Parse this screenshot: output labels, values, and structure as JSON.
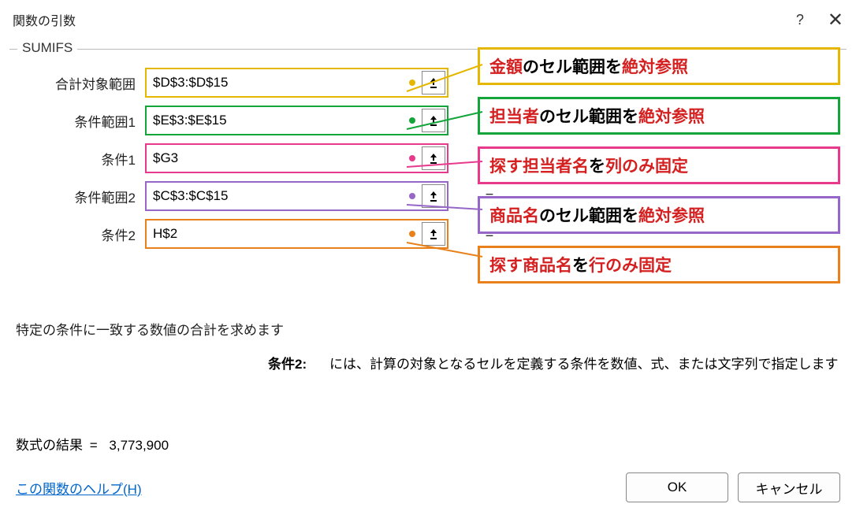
{
  "titlebar": {
    "title": "関数の引数",
    "help": "?",
    "close": "✕"
  },
  "group": {
    "label": "SUMIFS"
  },
  "rows": [
    {
      "label": "合計対象範囲",
      "value": "$D$3:$D$15",
      "color": "yellow"
    },
    {
      "label": "条件範囲1",
      "value": "$E$3:$E$15",
      "color": "green"
    },
    {
      "label": "条件1",
      "value": "$G3",
      "color": "pink"
    },
    {
      "label": "条件範囲2",
      "value": "$C$3:$C$15",
      "color": "purple"
    },
    {
      "label": "条件2",
      "value": "H$2",
      "color": "orange"
    }
  ],
  "equals": "=",
  "description": "特定の条件に一致する数値の合計を求めます",
  "arg_help": {
    "label": "条件2:",
    "text": "には、計算の対象となるセルを定義する条件を数値、式、または文字列で指定します"
  },
  "result": {
    "label": "数式の結果",
    "eq": "=",
    "value": "3,773,900"
  },
  "help_link": "この関数のヘルプ(H)",
  "buttons": {
    "ok": "OK",
    "cancel": "キャンセル"
  },
  "callouts": [
    {
      "color": "yellow",
      "red": "金額",
      "rest": "のセル範囲を",
      "red2": "絶対参照"
    },
    {
      "color": "green",
      "red": "担当者",
      "rest": "のセル範囲を",
      "red2": "絶対参照"
    },
    {
      "color": "pink",
      "red": "探す担当者名",
      "rest": "を",
      "red2": "列のみ固定"
    },
    {
      "color": "purple",
      "red": "商品名",
      "rest": "のセル範囲を",
      "red2": "絶対参照"
    },
    {
      "color": "orange",
      "red": "探す商品名",
      "rest": "を",
      "red2": "行のみ固定"
    }
  ]
}
